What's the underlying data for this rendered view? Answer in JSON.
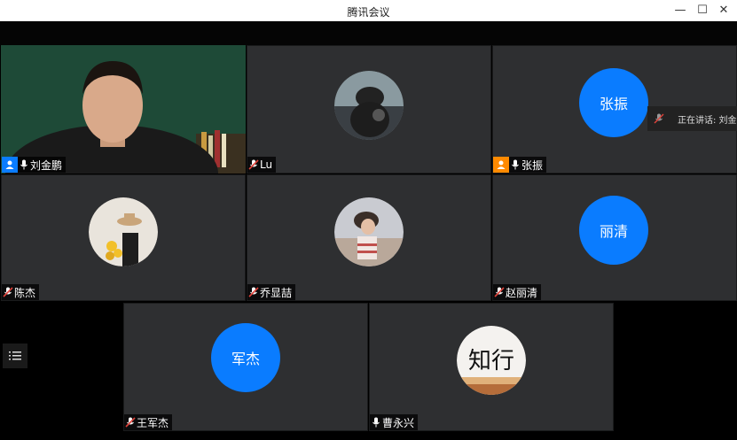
{
  "window": {
    "title": "腾讯会议"
  },
  "speaking": {
    "text": "正在讲话: 刘金"
  },
  "participants": [
    {
      "name": "刘金鹏"
    },
    {
      "name": "Lu"
    },
    {
      "name": "张振",
      "avatar_text": "张振"
    },
    {
      "name": "陈杰"
    },
    {
      "name": "乔显喆"
    },
    {
      "name": "赵丽清",
      "avatar_text": "丽清"
    },
    {
      "name": "王军杰",
      "avatar_text": "军杰"
    },
    {
      "name": "曹永兴",
      "avatar_text": "知行"
    }
  ],
  "colors": {
    "accent": "#0a7cff",
    "host_badge": "#0a7cff",
    "cohost_badge": "#ff8a00",
    "active_border": "#39b27b",
    "muted_mic": "#e0433b"
  },
  "icons": [
    "minimize-icon",
    "maximize-icon",
    "close-icon",
    "user-icon",
    "mic-icon",
    "mic-muted-icon",
    "list-menu-icon"
  ]
}
